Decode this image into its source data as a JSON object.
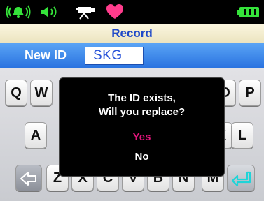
{
  "status_bar": {
    "icons": [
      "ring-vibrate-icon",
      "speaker-volume-icon",
      "camcorder-icon",
      "heart-icon",
      "battery-icon"
    ],
    "colors": {
      "accent_green": "#35e33a",
      "heart_pink": "#ff3c8c"
    }
  },
  "title": "Record",
  "id_row": {
    "label": "New ID",
    "value": "SKG"
  },
  "keyboard": {
    "keys": [
      "Q",
      "W",
      "O",
      "P",
      "A",
      "K",
      "L",
      "Z",
      "X",
      "C",
      "V",
      "B",
      "N",
      "M"
    ],
    "backspace_icon": "backspace-icon",
    "enter_icon": "enter-icon"
  },
  "dialog": {
    "line1": "The ID exists,",
    "line2": "Will you replace?",
    "yes": "Yes",
    "no": "No",
    "colors": {
      "yes": "#e0157a",
      "no": "#ffffff"
    }
  }
}
